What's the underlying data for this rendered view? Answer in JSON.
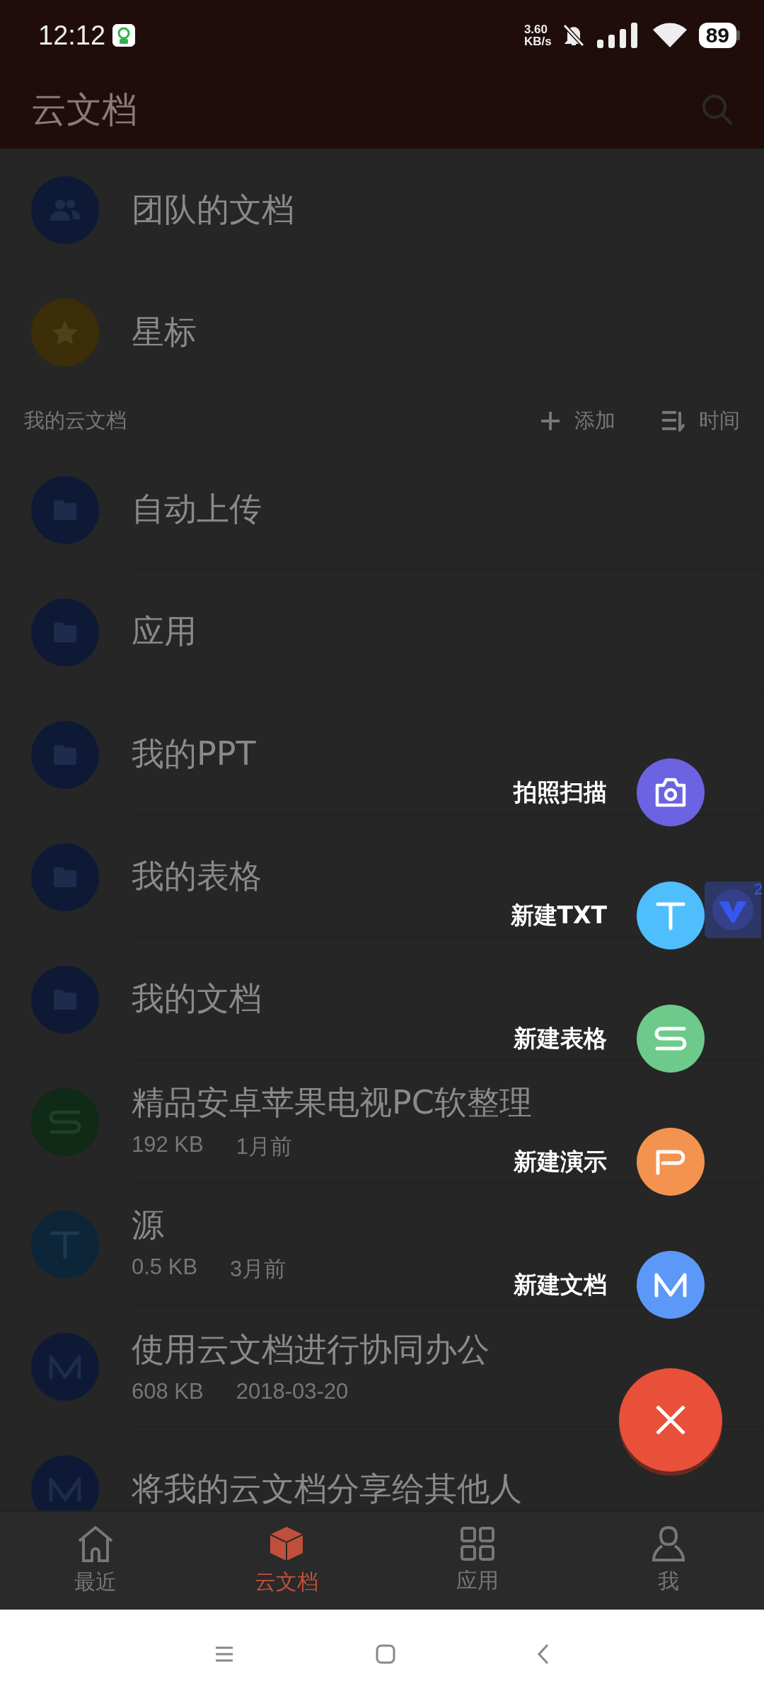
{
  "status_bar": {
    "time": "12:12",
    "net_speed_value": "3.60",
    "net_speed_unit": "KB/s",
    "battery": "89"
  },
  "app_bar": {
    "title": "云文档"
  },
  "shortcuts": [
    {
      "label": "团队的文档",
      "kind": "team"
    },
    {
      "label": "星标",
      "kind": "star"
    }
  ],
  "section": {
    "title": "我的云文档",
    "actions": [
      {
        "label": "添加",
        "kind": "add"
      },
      {
        "label": "时间",
        "kind": "sort"
      }
    ]
  },
  "items": [
    {
      "kind": "folder",
      "name": "自动上传"
    },
    {
      "kind": "folder",
      "name": "应用"
    },
    {
      "kind": "folder",
      "name": "我的PPT"
    },
    {
      "kind": "folder",
      "name": "我的表格"
    },
    {
      "kind": "folder",
      "name": "我的文档"
    },
    {
      "kind": "sheet",
      "name": "精品安卓苹果电视PC软整理",
      "size": "192 KB",
      "date": "1月前"
    },
    {
      "kind": "txt",
      "name": "源",
      "size": "0.5 KB",
      "date": "3月前"
    },
    {
      "kind": "doc",
      "name": "使用云文档进行协同办公",
      "size": "608 KB",
      "date": "2018-03-20"
    },
    {
      "kind": "doc",
      "name": "将我的云文档分享给其他人"
    }
  ],
  "fab_menu": [
    {
      "label": "拍照扫描",
      "kind": "scan"
    },
    {
      "label": "新建TXT",
      "kind": "txt"
    },
    {
      "label": "新建表格",
      "kind": "sheet"
    },
    {
      "label": "新建演示",
      "kind": "slide"
    },
    {
      "label": "新建文档",
      "kind": "doc"
    }
  ],
  "floating_badge": "2",
  "bottom_nav": [
    {
      "label": "最近",
      "kind": "home",
      "selected": false
    },
    {
      "label": "云文档",
      "kind": "cloud",
      "selected": true
    },
    {
      "label": "应用",
      "kind": "apps",
      "selected": false
    },
    {
      "label": "我",
      "kind": "me",
      "selected": false
    }
  ]
}
